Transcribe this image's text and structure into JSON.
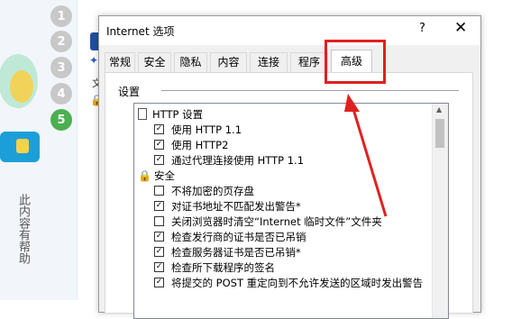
{
  "page_left": {
    "steps": [
      "1",
      "2",
      "3",
      "4",
      "5"
    ],
    "active_step": "5",
    "vertical_text": "此内容有帮助"
  },
  "dialog": {
    "title": "Internet 选项",
    "help_label": "?",
    "close_icon": "close-icon",
    "tabs": [
      "常规",
      "安全",
      "隐私",
      "内容",
      "连接",
      "程序",
      "高级"
    ],
    "selected_tab": "高级",
    "section_label": "设置",
    "settings": [
      {
        "type": "group",
        "icon": "page-icon",
        "label": "HTTP 设置"
      },
      {
        "type": "checkbox",
        "checked": true,
        "label": "使用 HTTP 1.1"
      },
      {
        "type": "checkbox",
        "checked": true,
        "label": "使用 HTTP2"
      },
      {
        "type": "checkbox",
        "checked": true,
        "label": "通过代理连接使用 HTTP 1.1"
      },
      {
        "type": "group",
        "icon": "lock-icon",
        "label": "安全"
      },
      {
        "type": "checkbox",
        "checked": false,
        "label": "不将加密的页存盘"
      },
      {
        "type": "checkbox",
        "checked": true,
        "label": "对证书地址不匹配发出警告*"
      },
      {
        "type": "checkbox",
        "checked": false,
        "label": "关闭浏览器时清空“Internet 临时文件”文件夹"
      },
      {
        "type": "checkbox",
        "checked": true,
        "label": "检查发行商的证书是否已吊销"
      },
      {
        "type": "checkbox",
        "checked": true,
        "label": "检查服务器证书是否已吊销*"
      },
      {
        "type": "checkbox",
        "checked": true,
        "label": "检查所下载程序的签名"
      },
      {
        "type": "checkbox",
        "checked": true,
        "label": "将提交的 POST 重定向到不允许发送的区域时发出警告"
      }
    ]
  },
  "colors": {
    "highlight": "#e02020",
    "active_step": "#4caf50",
    "inactive_step": "#c8c8c8"
  }
}
